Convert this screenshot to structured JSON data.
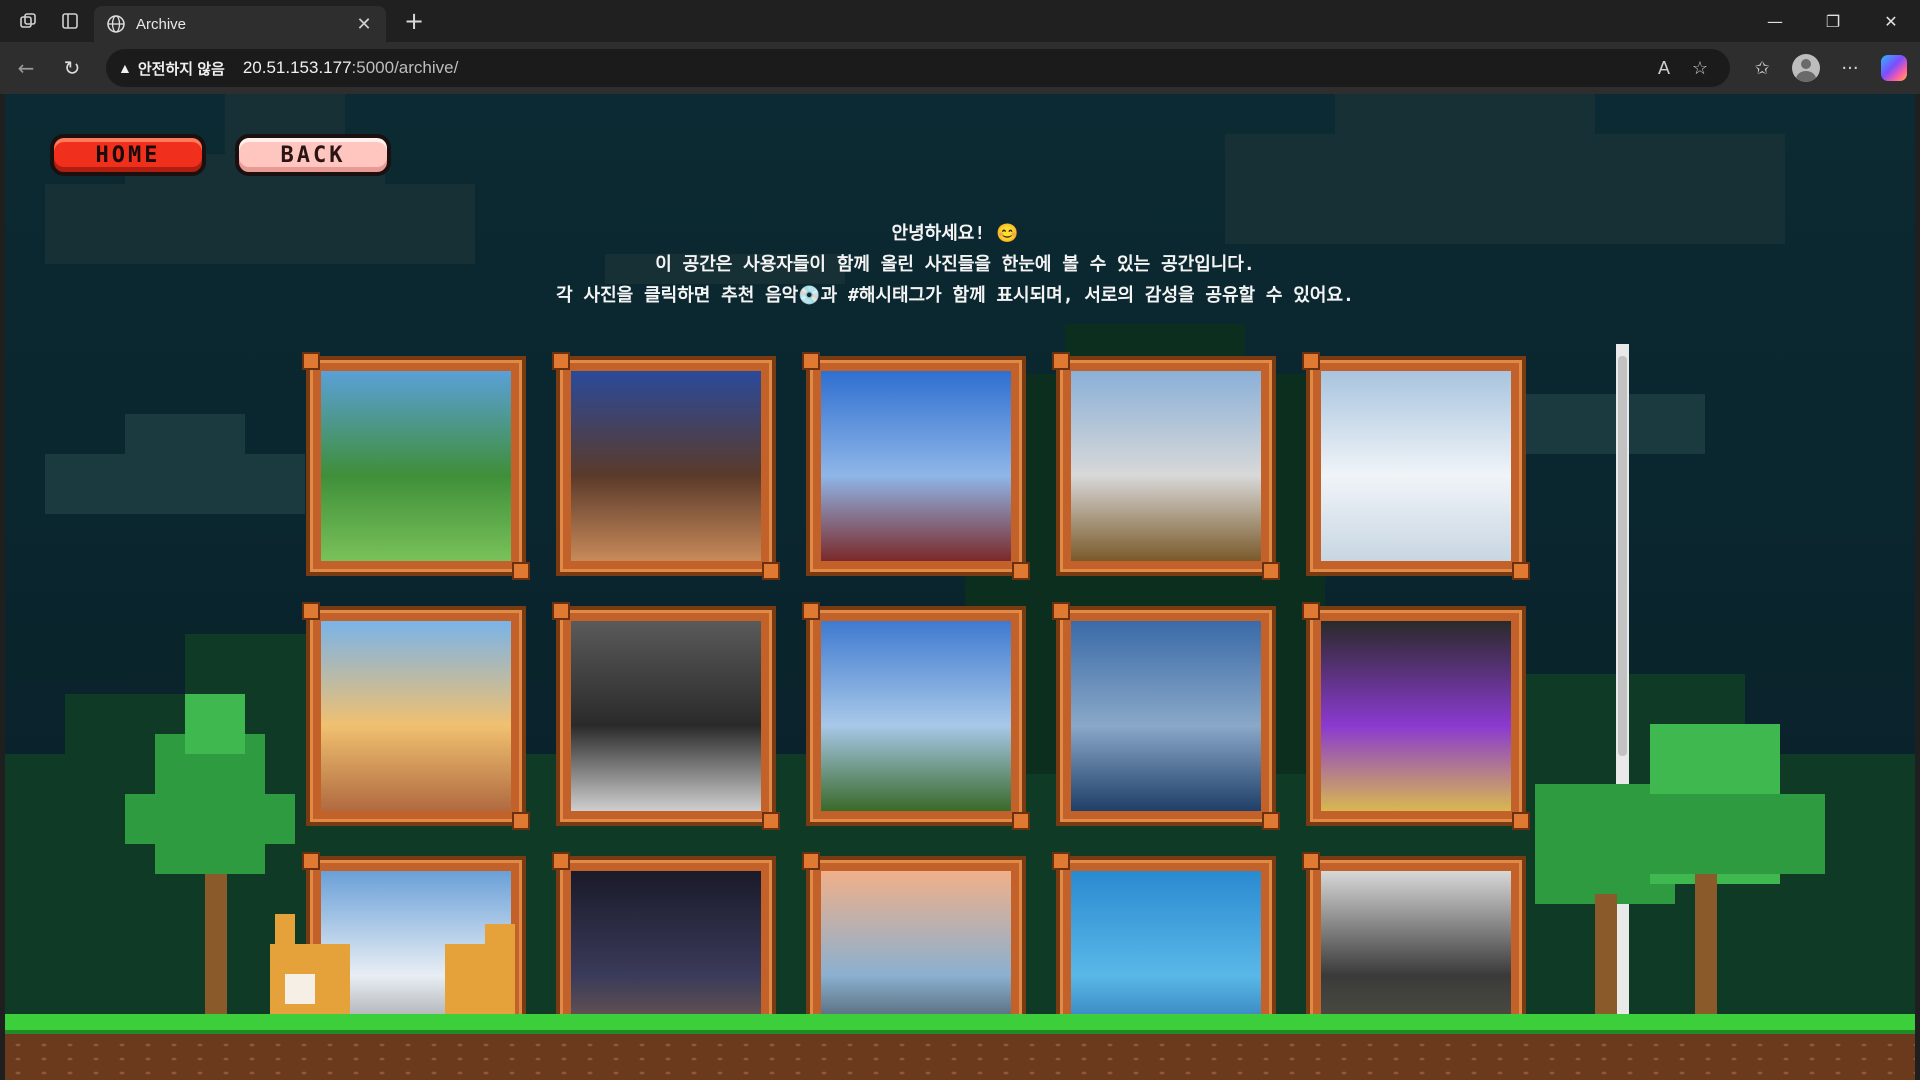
{
  "browser": {
    "tab_title": "Archive",
    "security_label": "안전하지 않음",
    "url_host": "20.51.153.177",
    "url_path": ":5000/archive/"
  },
  "page": {
    "home_label": "HOME",
    "back_label": "BACK",
    "intro_line1": "안녕하세요! 😊",
    "intro_line2": "이 공간은 사용자들이 함께 올린 사진들을 한눈에 볼 수 있는 공간입니다.",
    "intro_line3": "각 사진을 클릭하면 추천 음악💿과 #해시태그가 함께 표시되며, 서로의 감성을 공유할 수 있어요."
  },
  "icons": [
    "workspaces-icon",
    "vertical-tabs-icon",
    "globe-icon",
    "close-icon",
    "new-tab-icon",
    "minimize-icon",
    "restore-icon",
    "window-close-icon",
    "back-icon",
    "reload-icon",
    "warning-icon",
    "read-aloud-icon",
    "favorite-star-icon",
    "favorites-icon",
    "profile-avatar",
    "more-icon",
    "copilot-icon"
  ],
  "photos": [
    {
      "subject": "lake-forest",
      "colors": [
        "#5aa0d8",
        "#3f8f3a",
        "#79c25a"
      ]
    },
    {
      "subject": "city-towers",
      "colors": [
        "#2a4a9a",
        "#5a3a2a",
        "#c88a5a"
      ]
    },
    {
      "subject": "ferris-wheel",
      "colors": [
        "#2f6fd0",
        "#8fb6e8",
        "#7a2a2a"
      ]
    },
    {
      "subject": "snowy-stream",
      "colors": [
        "#8ab0d8",
        "#d8d8d8",
        "#7a5a2a"
      ]
    },
    {
      "subject": "snow-mountain",
      "colors": [
        "#a8c4de",
        "#f0f4f8",
        "#c8d6e2"
      ]
    },
    {
      "subject": "town-bus",
      "colors": [
        "#7ab4e8",
        "#f0c070",
        "#b06a40"
      ]
    },
    {
      "subject": "train-station",
      "colors": [
        "#5a5a5a",
        "#2a2a2a",
        "#cfcfcf"
      ]
    },
    {
      "subject": "mountain-valley",
      "colors": [
        "#3f7ad0",
        "#a8c8e8",
        "#3a6a2a"
      ]
    },
    {
      "subject": "sea-bridge",
      "colors": [
        "#3a6aa8",
        "#8aa8c8",
        "#1f3f68"
      ]
    },
    {
      "subject": "purple-tower",
      "colors": [
        "#2a2a2a",
        "#8a3ad0",
        "#d8b850"
      ]
    },
    {
      "subject": "sky-city",
      "colors": [
        "#6aa0d8",
        "#e8eef4",
        "#7a7a7a"
      ]
    },
    {
      "subject": "night-city",
      "colors": [
        "#1a1a2a",
        "#3a3a5a",
        "#8a6a4a"
      ]
    },
    {
      "subject": "sunset-river",
      "colors": [
        "#f0b08a",
        "#8ab0d0",
        "#2a2a2a"
      ]
    },
    {
      "subject": "clear-sea",
      "colors": [
        "#2a8ad0",
        "#5ab8e8",
        "#1a5a9a"
      ]
    },
    {
      "subject": "big-tree",
      "colors": [
        "#d8d8d8",
        "#3a3a3a",
        "#5a5a4a"
      ]
    }
  ],
  "colors": {
    "home_button": "#f0301c",
    "back_button": "#ffc6c0",
    "frame": "#c3612a",
    "grass": "#3ccf3b"
  }
}
